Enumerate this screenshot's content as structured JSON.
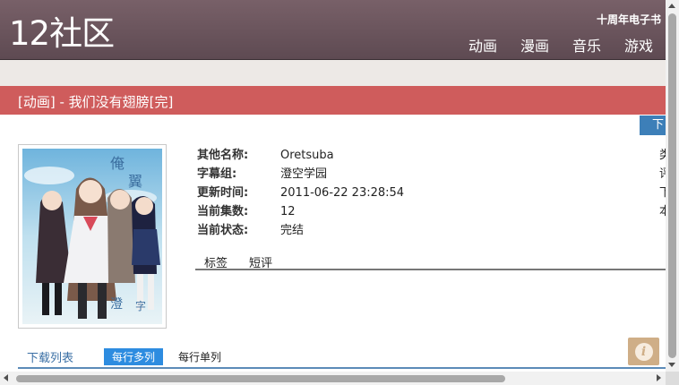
{
  "header": {
    "logo": "12社区",
    "anniversary": "十周年电子书",
    "nav": [
      "动画",
      "漫画",
      "音乐",
      "游戏"
    ]
  },
  "title_bar": "[动画] - 我们没有翅膀[完]",
  "download_button": "下",
  "poster": {
    "alt": "Oretsuba cover art"
  },
  "info": {
    "rows": [
      {
        "label": "其他名称:",
        "value": "Oretsuba"
      },
      {
        "label": "字幕组:",
        "value": "澄空学园"
      },
      {
        "label": "更新时间:",
        "value": "2011-06-22 23:28:54"
      },
      {
        "label": "当前集数:",
        "value": "12"
      },
      {
        "label": "当前状态:",
        "value": "完结"
      }
    ],
    "right_column": [
      "类",
      "评",
      "下",
      "本"
    ]
  },
  "tabs": [
    "标签",
    "短评"
  ],
  "download_list": {
    "title": "下载列表",
    "multi_per_row": "每行多列",
    "single_per_row": "每行单列"
  },
  "colors": {
    "header": "#6e5860",
    "title_bar": "#cf5c5c",
    "accent_blue": "#2d8ce0",
    "download_button": "#3d7fb8"
  },
  "icons": {
    "info": "info-icon"
  }
}
